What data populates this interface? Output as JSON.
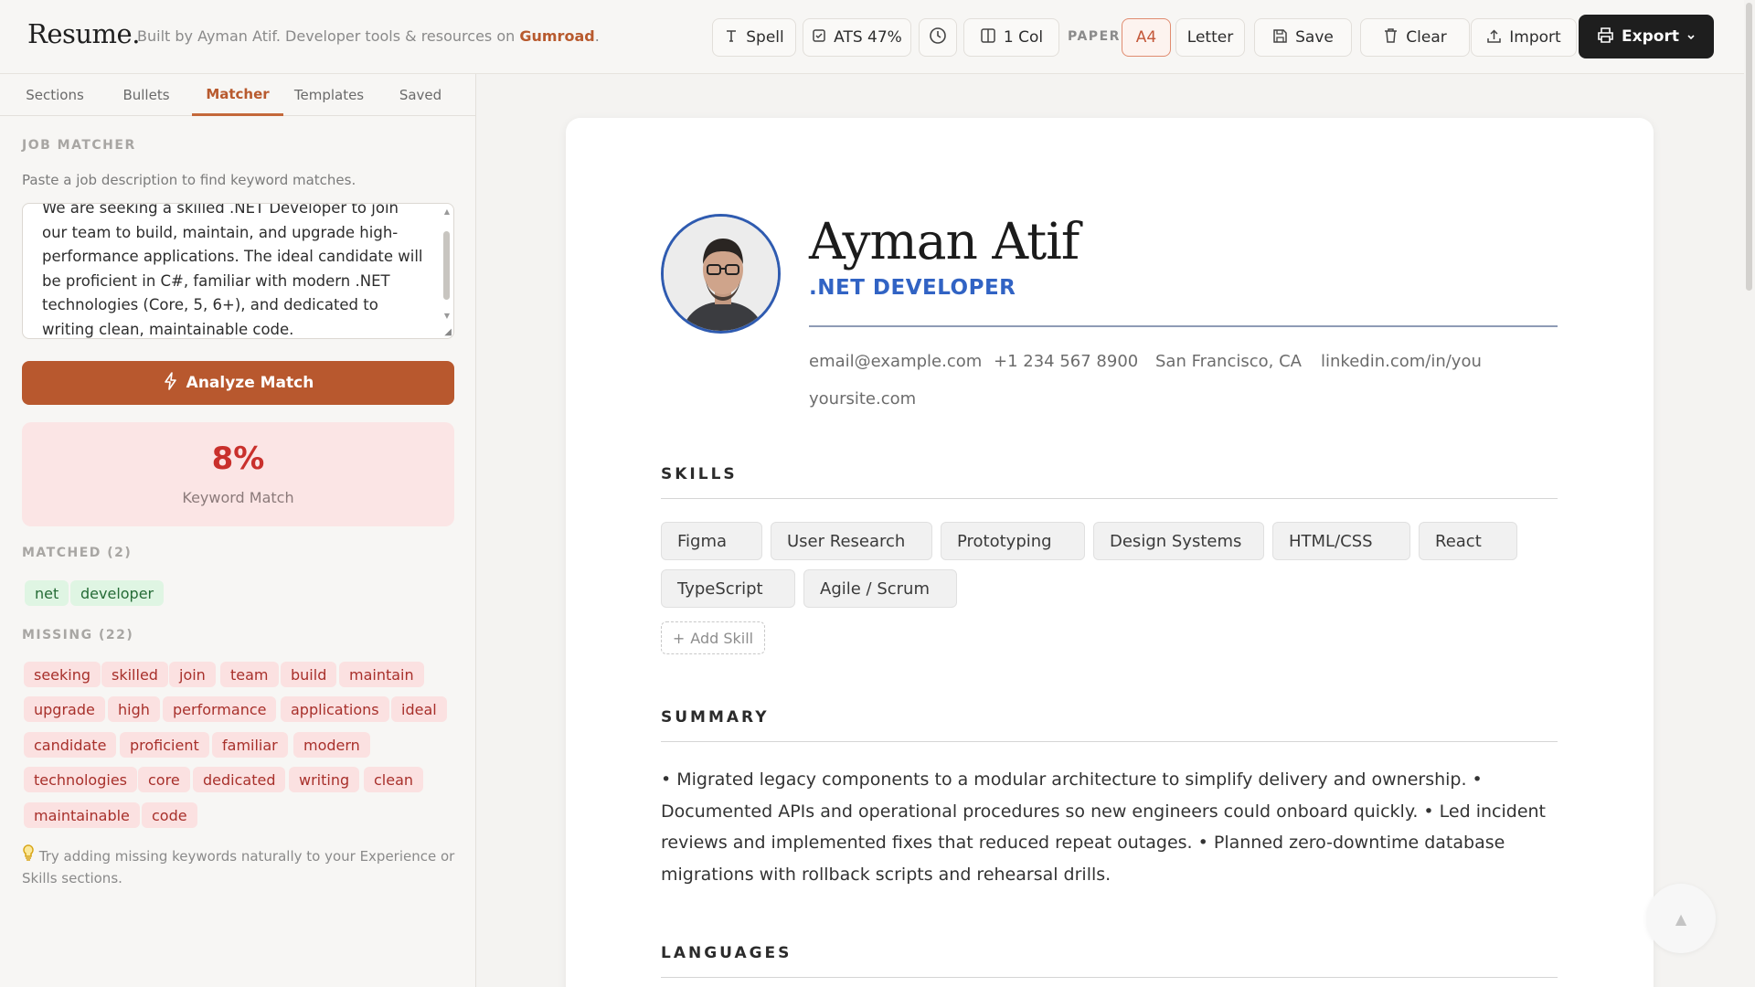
{
  "brand": {
    "logo": "Resume.",
    "tagline_prefix": "Built by Ayman Atif. Developer tools & resources on",
    "tagline_link": "Gumroad",
    "tagline_suffix": "."
  },
  "toolbar": {
    "spell": "Spell",
    "ats": "ATS 47%",
    "columns": "1 Col",
    "paper_label": "PAPER",
    "a4": "A4",
    "letter": "Letter",
    "save": "Save",
    "clear": "Clear",
    "import": "Import",
    "export": "Export"
  },
  "tabs": [
    "Sections",
    "Bullets",
    "Matcher",
    "Templates",
    "Saved"
  ],
  "matcher": {
    "heading": "JOB MATCHER",
    "hint": "Paste a job description to find keyword matches.",
    "job_description": "We are seeking a skilled .NET Developer to join our team to build, maintain, and upgrade high-performance applications. The ideal candidate will be proficient in C#, familiar with modern .NET technologies (Core, 5, 6+), and dedicated to writing clean, maintainable code.",
    "analyze_label": "Analyze Match",
    "score": "8%",
    "score_label": "Keyword Match",
    "matched_heading": "MATCHED (2)",
    "matched": [
      "net",
      "developer"
    ],
    "missing_heading": "MISSING (22)",
    "missing": [
      "seeking",
      "skilled",
      "join",
      "team",
      "build",
      "maintain",
      "upgrade",
      "high",
      "performance",
      "applications",
      "ideal",
      "candidate",
      "proficient",
      "familiar",
      "modern",
      "technologies",
      "core",
      "dedicated",
      "writing",
      "clean",
      "maintainable",
      "code"
    ],
    "tip": "Try adding missing keywords naturally to your Experience or Skills sections."
  },
  "resume": {
    "name": "Ayman Atif",
    "role": ".NET DEVELOPER",
    "contacts": [
      "email@example.com",
      "+1 234 567 8900",
      "San Francisco, CA",
      "linkedin.com/in/you",
      "yoursite.com"
    ],
    "skills_heading": "SKILLS",
    "skills": [
      "Figma",
      "User Research",
      "Prototyping",
      "Design Systems",
      "HTML/CSS",
      "React",
      "TypeScript",
      "Agile / Scrum"
    ],
    "add_skill": "Add Skill",
    "summary_heading": "SUMMARY",
    "summary": "• Migrated legacy components to a modular architecture to simplify delivery and ownership. • Documented APIs and operational procedures so new engineers could onboard quickly. • Led incident reviews and implemented fixes that reduced repeat outages. • Planned zero-downtime database migrations with rollback scripts and rehearsal drills.",
    "languages_heading": "LANGUAGES"
  },
  "colors": {
    "accent": "#b8582e",
    "role_blue": "#3163c4",
    "match_green": "#256b36",
    "miss_red": "#a8302b",
    "score_red": "#c9302c"
  },
  "icons": {
    "spell": "type-icon",
    "ats": "check-square-icon",
    "history": "clock-icon",
    "columns": "columns-icon",
    "save": "floppy-icon",
    "clear": "trash-icon",
    "import": "upload-icon",
    "export": "printer-icon",
    "analyze": "lightning-icon",
    "tip": "lightbulb-icon",
    "scroll_top": "arrow-up-icon"
  }
}
